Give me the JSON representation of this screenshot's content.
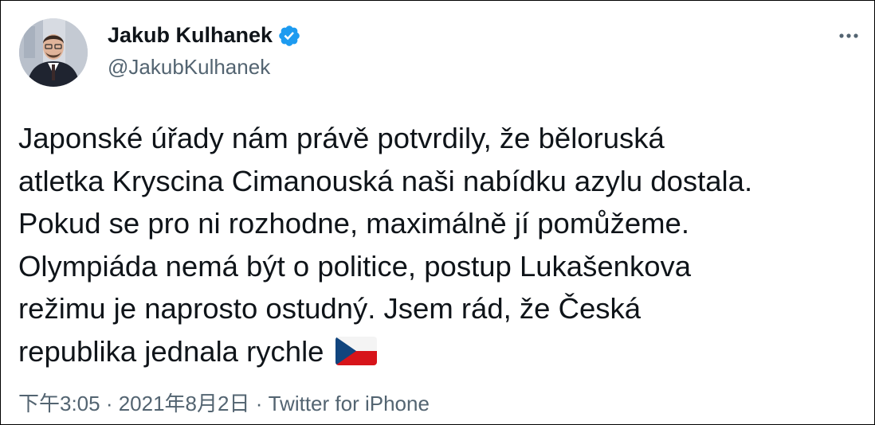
{
  "author": {
    "display_name": "Jakub Kulhanek",
    "handle": "@JakubKulhanek",
    "verified": true,
    "verified_icon": "verified-badge-icon",
    "avatar_icon": "profile-photo"
  },
  "menu": {
    "icon": "more-horizontal-icon"
  },
  "tweet": {
    "lines": [
      "Japonské úřady nám právě potvrdily, že běloruská",
      "atletka Kryscina Cimanouská naši nabídku azylu dostala.",
      "Pokud se pro ni rozhodne, maximálně jí pomůžeme.",
      "Olympiáda nemá být o politice, postup Lukašenkova",
      "režimu je naprosto ostudný. Jsem rád, že Česká",
      "republika jednala rychle"
    ],
    "emoji": "czech-flag-icon"
  },
  "meta": {
    "time": "下午3:05",
    "separator": " · ",
    "date": "2021年8月2日",
    "source": "Twitter for iPhone"
  },
  "colors": {
    "text": "#0f1419",
    "secondary": "#536471",
    "verified": "#1d9bf0",
    "flag_white": "#ffffff",
    "flag_red": "#d7141a",
    "flag_blue": "#11457e"
  }
}
